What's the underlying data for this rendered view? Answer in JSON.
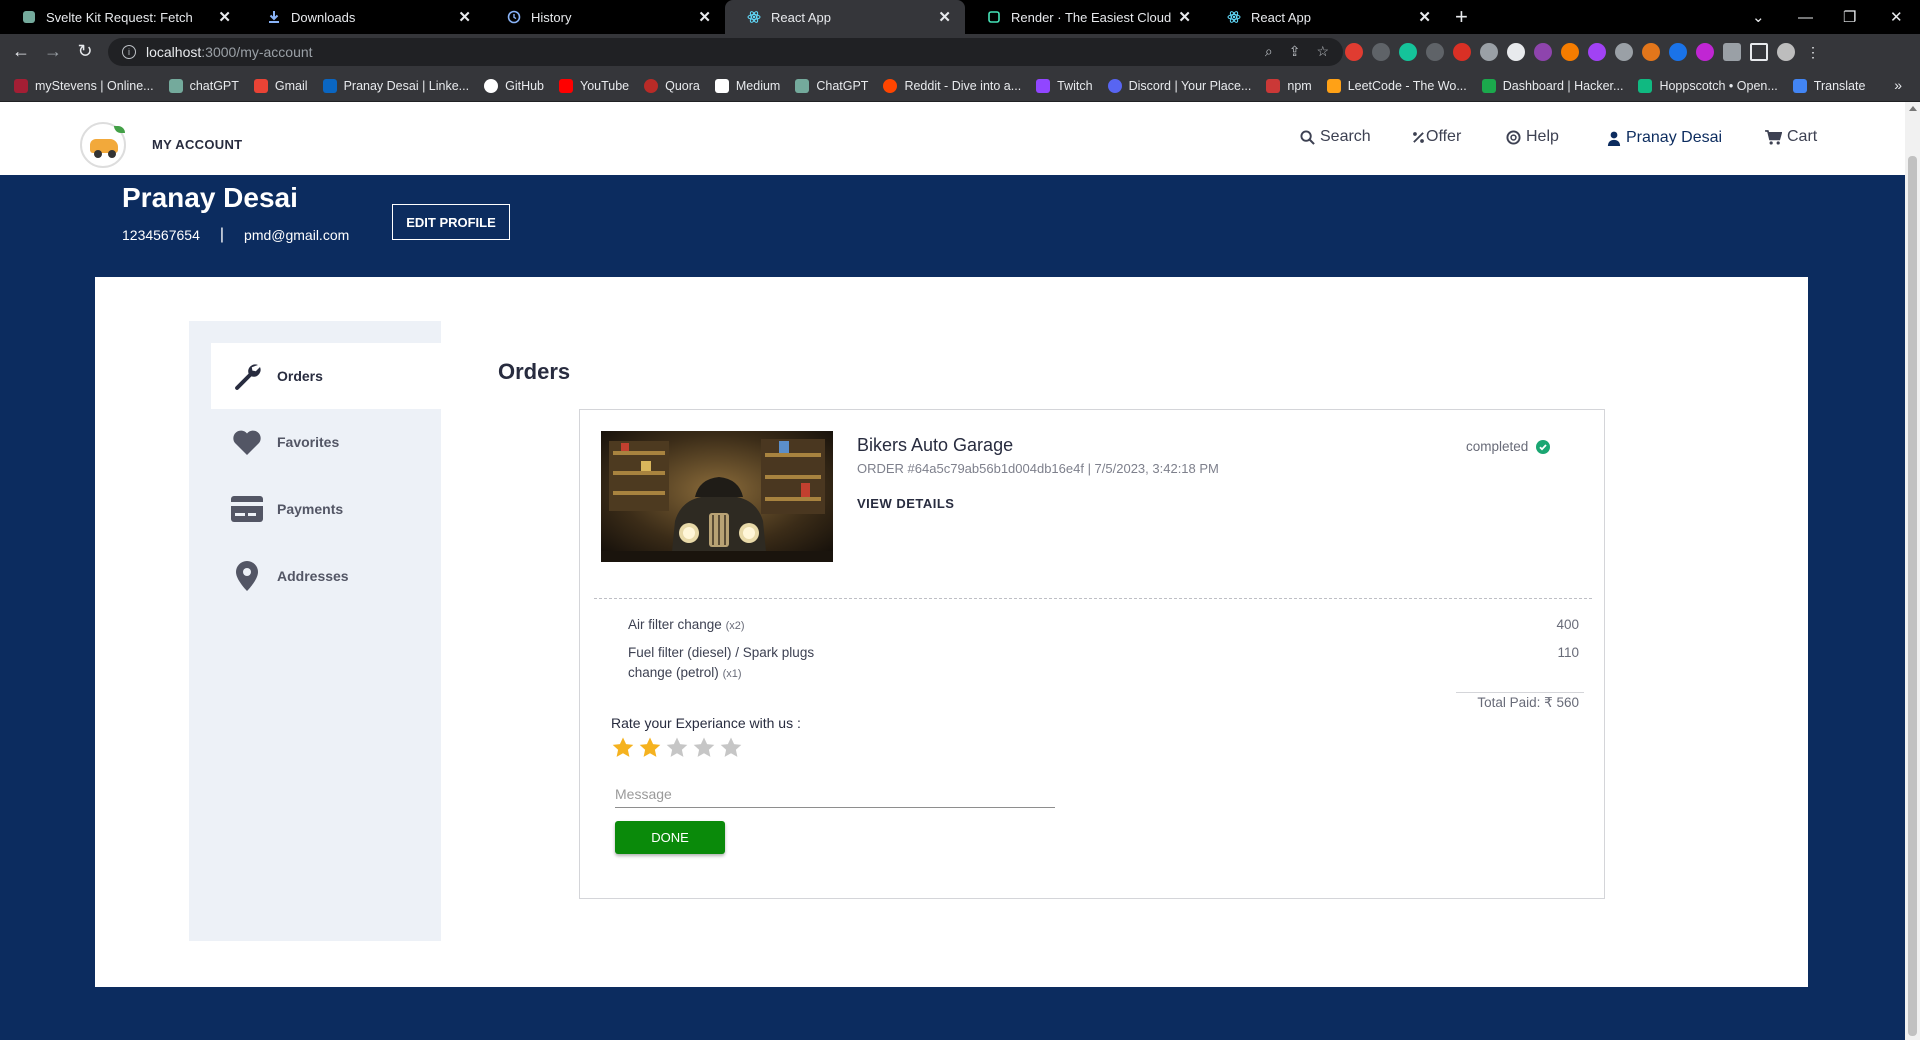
{
  "browser": {
    "tabs": [
      {
        "title": "Svelte Kit Request: Fetch",
        "icon": "chatgpt-icon",
        "color": "#74aa9c"
      },
      {
        "title": "Downloads",
        "icon": "download-icon",
        "color": "#8ab4f8"
      },
      {
        "title": "History",
        "icon": "history-icon",
        "color": "#8ab4f8"
      },
      {
        "title": "React App",
        "icon": "react-icon",
        "color": "#61dafb",
        "active": true
      },
      {
        "title": "Render · The Easiest Cloud For Al",
        "icon": "render-icon",
        "color": "#46e3b7"
      },
      {
        "title": "React App",
        "icon": "react-icon",
        "color": "#61dafb"
      }
    ],
    "url_host": "localhost",
    "url_path": ":3000/my-account",
    "bookmarks": [
      {
        "label": "myStevens | Online...",
        "color": "#a41e34"
      },
      {
        "label": "chatGPT",
        "color": "#74aa9c"
      },
      {
        "label": "Gmail",
        "color": "#ea4335"
      },
      {
        "label": "Pranay Desai | Linke...",
        "color": "#0a66c2"
      },
      {
        "label": "GitHub",
        "color": "#ffffff"
      },
      {
        "label": "YouTube",
        "color": "#ff0000"
      },
      {
        "label": "Quora",
        "color": "#b92b27"
      },
      {
        "label": "Medium",
        "color": "#ffffff"
      },
      {
        "label": "ChatGPT",
        "color": "#74aa9c"
      },
      {
        "label": "Reddit - Dive into a...",
        "color": "#ff4500"
      },
      {
        "label": "Twitch",
        "color": "#9146ff"
      },
      {
        "label": "Discord | Your Place...",
        "color": "#5865f2"
      },
      {
        "label": "npm",
        "color": "#cb3837"
      },
      {
        "label": "LeetCode - The Wo...",
        "color": "#ffa116"
      },
      {
        "label": "Dashboard | Hacker...",
        "color": "#1ba94c"
      },
      {
        "label": "Hoppscotch • Open...",
        "color": "#10b981"
      },
      {
        "label": "Translate",
        "color": "#4285f4"
      }
    ],
    "more": "»"
  },
  "site": {
    "brand": "MY ACCOUNT",
    "nav": {
      "search": "Search",
      "offer": "Offer",
      "help": "Help",
      "user": "Pranay Desai",
      "cart": "Cart"
    }
  },
  "profile": {
    "name": "Pranay Desai",
    "phone": "1234567654",
    "separator": "|",
    "email": "pmd@gmail.com",
    "edit_label": "EDIT PROFILE"
  },
  "sidebar": {
    "items": [
      {
        "label": "Orders",
        "icon": "wrench-icon",
        "active": true
      },
      {
        "label": "Favorites",
        "icon": "heart-icon"
      },
      {
        "label": "Payments",
        "icon": "credit-card-icon"
      },
      {
        "label": "Addresses",
        "icon": "location-pin-icon"
      }
    ]
  },
  "orders": {
    "title": "Orders",
    "order": {
      "garage": "Bikers Auto Garage",
      "meta": "ORDER #64a5c79ab56b1d004db16e4f | 7/5/2023, 3:42:18 PM",
      "view_details": "VIEW DETAILS",
      "status": "completed",
      "items": [
        {
          "name": "Air filter change",
          "qty": "(x2)",
          "amount": "400"
        },
        {
          "name_line1": "Fuel filter (diesel) / Spark plugs",
          "name_line2": "change (petrol)",
          "qty": "(x1)",
          "amount": "110"
        }
      ],
      "total": "Total Paid: ₹ 560",
      "rate_label": "Rate your Experiance with us :",
      "rating": 2,
      "max_rating": 5,
      "message_placeholder": "Message",
      "done_label": "DONE"
    }
  },
  "colors": {
    "navy": "#0c2c5f",
    "star_filled": "#f5b21f",
    "star_empty": "#c6c6c6",
    "done_green": "#0a8a0a",
    "status_green": "#1ba672"
  }
}
